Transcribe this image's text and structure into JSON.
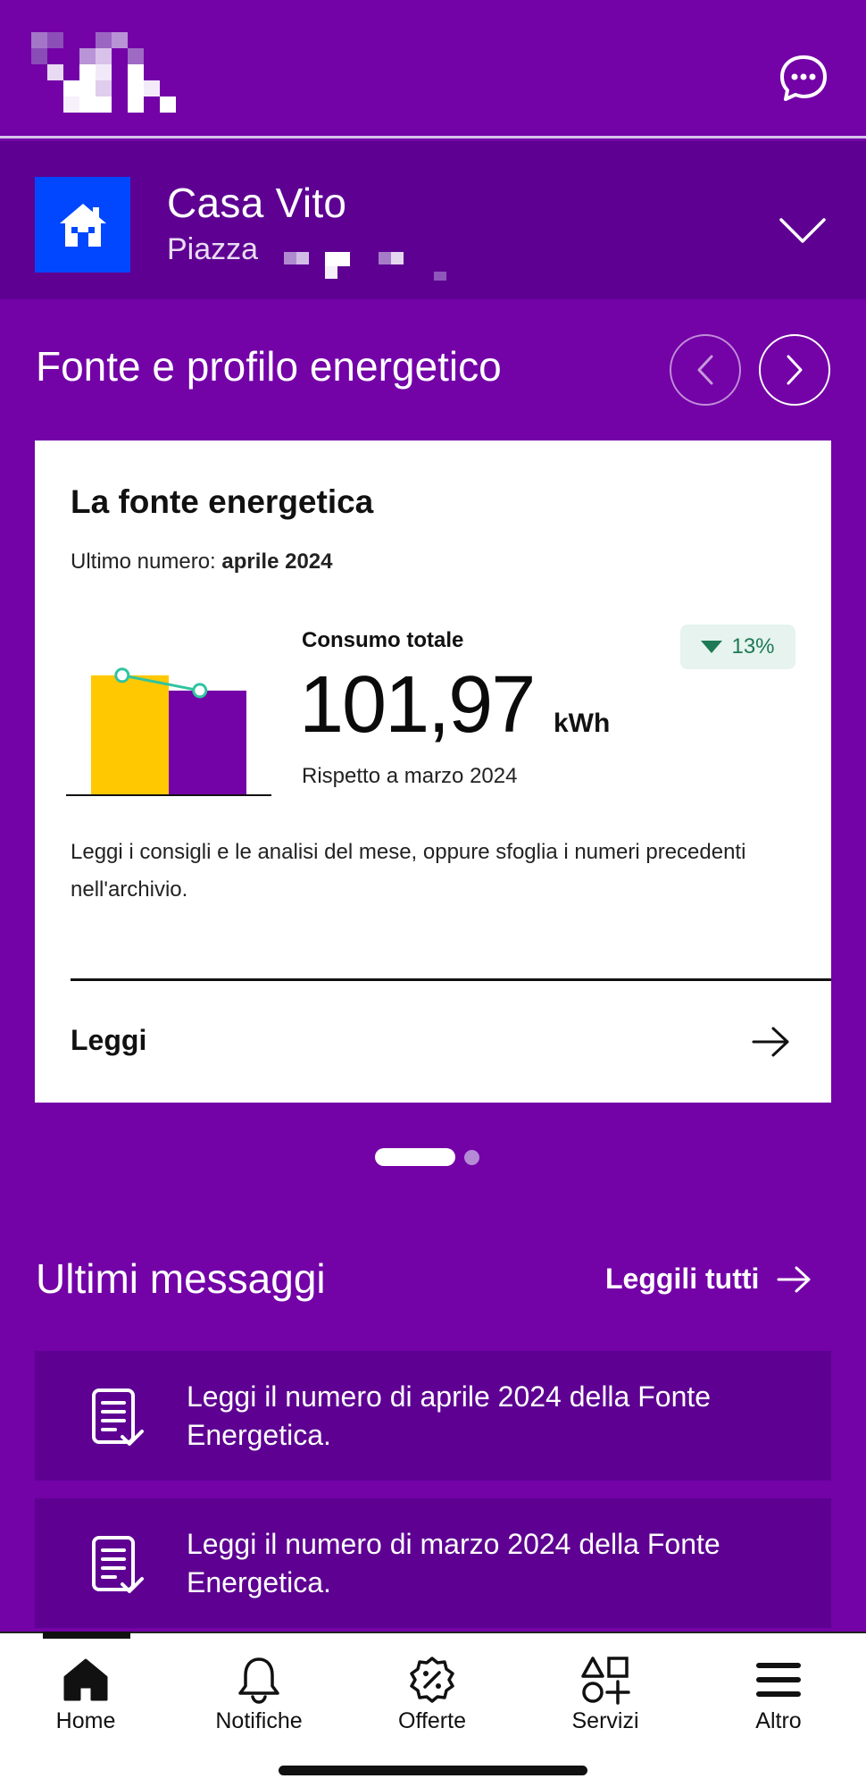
{
  "header": {
    "logo_icon": "pixelated-logo",
    "chat_icon": "chat-bubble-icon"
  },
  "home": {
    "name": "Casa Vito",
    "address_label": "Piazza",
    "icon": "house-icon"
  },
  "section": {
    "title": "Fonte e profilo energetico"
  },
  "card": {
    "title": "La fonte energetica",
    "issue_label": "Ultimo numero:",
    "issue_value": "aprile 2024",
    "consumo_label": "Consumo totale",
    "consumo_value": "101,97",
    "consumo_unit": "kWh",
    "confronto": "Rispetto a marzo 2024",
    "badge": "13%",
    "description": "Leggi i consigli e le analisi del mese, oppure sfoglia i numeri precedenti nell'archivio.",
    "cta": "Leggi"
  },
  "chart_data": {
    "type": "bar",
    "categories": [
      "marzo 2024",
      "aprile 2024"
    ],
    "values": [
      117,
      101.97
    ],
    "colors": [
      "#ffc800",
      "#7302a7"
    ],
    "line_color": "#2fc4a0",
    "ylim": [
      0,
      130
    ]
  },
  "carousel": {
    "pages": 2,
    "active": 0
  },
  "messages": {
    "title": "Ultimi messaggi",
    "see_all": "Leggili tutti",
    "items": [
      {
        "text": "Leggi il numero di aprile 2024 della Fonte Energetica."
      },
      {
        "text": "Leggi il numero di marzo 2024 della Fonte Energetica."
      }
    ]
  },
  "bottom_nav": {
    "items": [
      {
        "label": "Home",
        "icon": "home-icon"
      },
      {
        "label": "Notifiche",
        "icon": "bell-icon"
      },
      {
        "label": "Offerte",
        "icon": "discount-badge-icon"
      },
      {
        "label": "Servizi",
        "icon": "shapes-icon"
      },
      {
        "label": "Altro",
        "icon": "menu-icon"
      }
    ]
  },
  "colors": {
    "brand_purple": "#7302a7",
    "dark_purple": "#5e0192",
    "home_blue": "#0047ff",
    "badge_green": "#1e7a55"
  }
}
